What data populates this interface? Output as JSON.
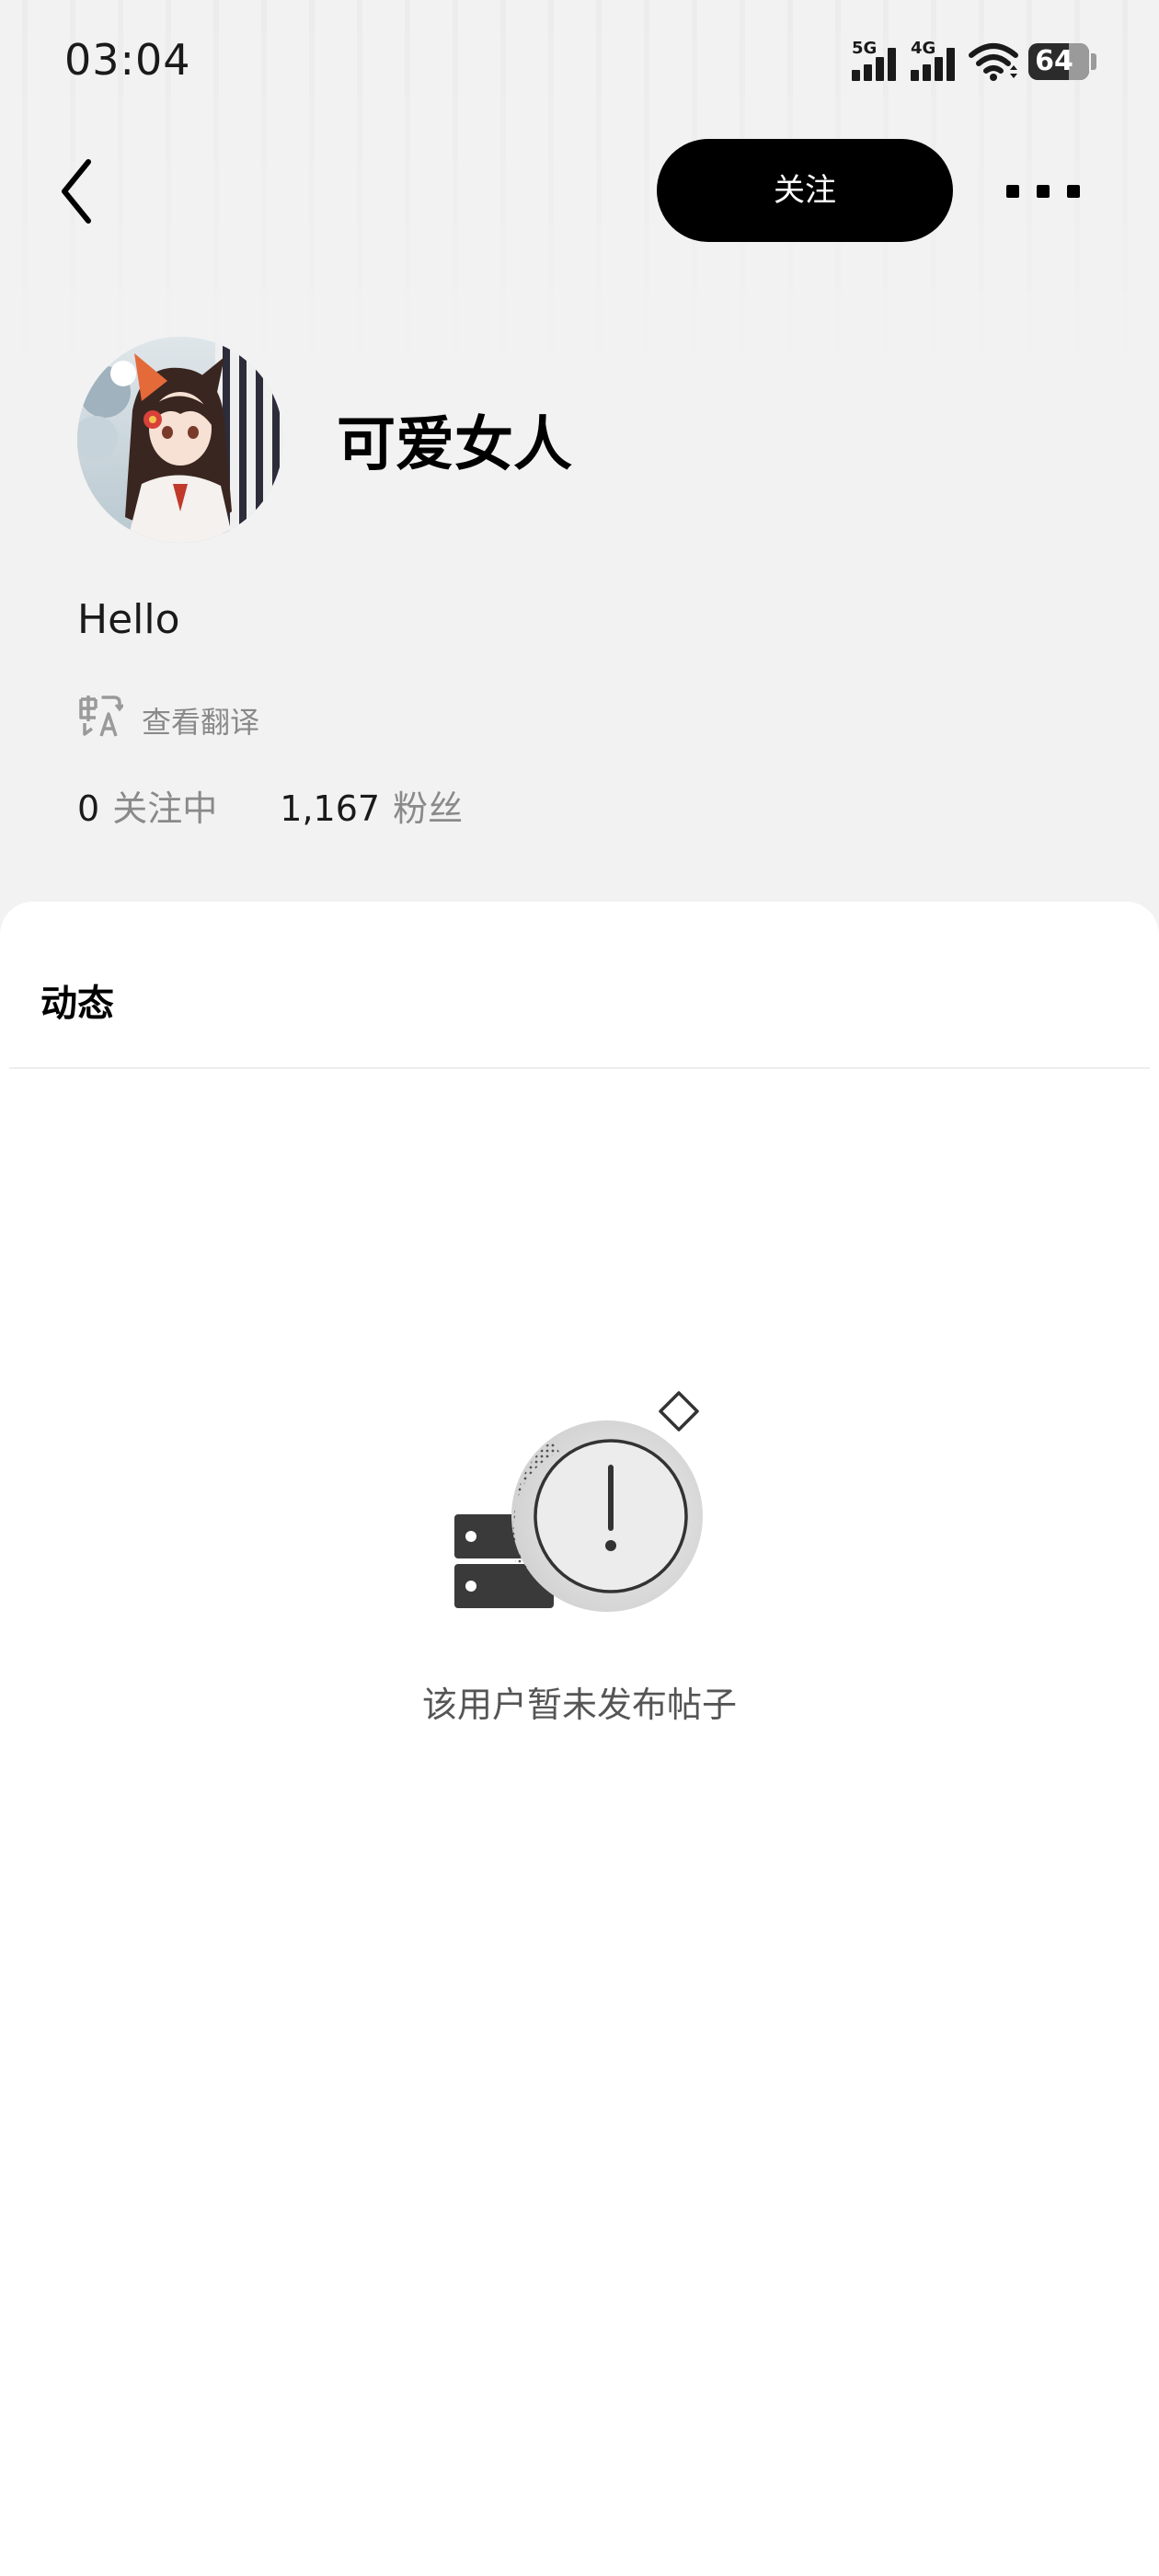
{
  "status_bar": {
    "time": "03:04",
    "network_1": "5G",
    "network_2": "4G",
    "battery": "64",
    "icons": [
      "signal-5g-icon",
      "signal-4g-icon",
      "wifi-icon",
      "battery-icon"
    ]
  },
  "nav": {
    "back_icon": "chevron-left-icon",
    "follow_label": "关注",
    "more_icon": "more-dots-icon"
  },
  "profile": {
    "username": "可爱女人",
    "bio": "Hello",
    "translate_label": "查看翻译",
    "translate_icon": "translate-icon",
    "following_count": "0",
    "following_label": "关注中",
    "followers_count": "1,167",
    "followers_label": "粉丝"
  },
  "tabs": {
    "posts_label": "动态"
  },
  "empty_state": {
    "icon": "empty-posts-icon",
    "message": "该用户暂未发布帖子"
  },
  "colors": {
    "header_bg": "#f2f2f2",
    "sheet_bg": "#ffffff",
    "button_bg": "#000000",
    "muted_text": "#8a8a8a"
  }
}
